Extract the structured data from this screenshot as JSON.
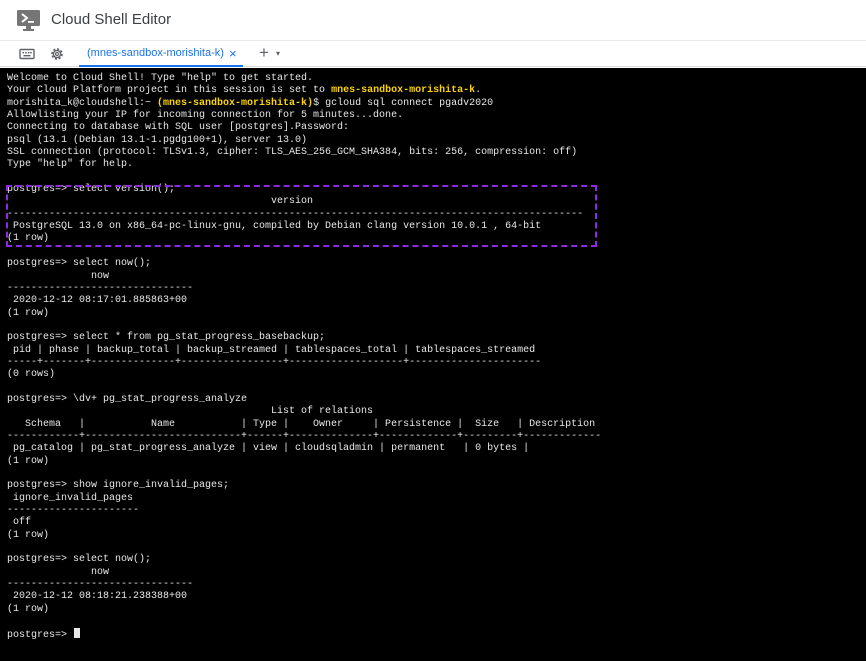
{
  "app": {
    "title": "Cloud Shell Editor"
  },
  "toolbar": {
    "keyboard_icon": "keyboard-icon",
    "settings_icon": "gear-icon",
    "tab_label": "(mnes-sandbox-morishita-k)",
    "tab_close": "×",
    "add_tab": "+",
    "add_caret": "▾"
  },
  "colors": {
    "tab_accent": "#1a73e8",
    "project_highlight": "#fbd400",
    "annotation_box": "#8a2be2",
    "terminal_bg": "#000000"
  },
  "terminal": {
    "l1": "Welcome to Cloud Shell! Type \"help\" to get started.",
    "l2_pre": "Your Cloud Platform project in this session is set to ",
    "l2_proj": "mnes-sandbox-morishita-k",
    "l2_post": ".",
    "l3_pre": "morishita_k@cloudshell:~ ",
    "l3_proj": "(mnes-sandbox-morishita-k)",
    "l3_post": "$ gcloud sql connect pgadv2020",
    "l4": "Allowlisting your IP for incoming connection for 5 minutes...done.",
    "l5": "Connecting to database with SQL user [postgres].Password:",
    "l6": "psql (13.1 (Debian 13.1-1.pgdg100+1), server 13.0)",
    "l7": "SSL connection (protocol: TLSv1.3, cipher: TLS_AES_256_GCM_SHA384, bits: 256, compression: off)",
    "l8": "Type \"help\" for help.",
    "l9": "",
    "l10": "postgres=> select version();",
    "l11": "                                            version",
    "l12": "------------------------------------------------------------------------------------------------",
    "l13": " PostgreSQL 13.0 on x86_64-pc-linux-gnu, compiled by Debian clang version 10.0.1 , 64-bit",
    "l14": "(1 row)",
    "l15": "",
    "l16": "postgres=> select now();",
    "l17": "              now",
    "l18": "-------------------------------",
    "l19": " 2020-12-12 08:17:01.885863+00",
    "l20": "(1 row)",
    "l21": "",
    "l22": "postgres=> select * from pg_stat_progress_basebackup;",
    "l23": " pid | phase | backup_total | backup_streamed | tablespaces_total | tablespaces_streamed",
    "l24": "-----+-------+--------------+-----------------+-------------------+----------------------",
    "l25": "(0 rows)",
    "l26": "",
    "l27": "postgres=> \\dv+ pg_stat_progress_analyze",
    "l28": "                                            List of relations",
    "l29": "   Schema   |           Name           | Type |    Owner     | Persistence |  Size   | Description",
    "l30": "------------+--------------------------+------+--------------+-------------+---------+-------------",
    "l31": " pg_catalog | pg_stat_progress_analyze | view | cloudsqladmin | permanent   | 0 bytes |",
    "l32": "(1 row)",
    "l33": "",
    "l34": "postgres=> show ignore_invalid_pages;",
    "l35": " ignore_invalid_pages",
    "l36": "----------------------",
    "l37": " off",
    "l38": "(1 row)",
    "l39": "",
    "l40": "postgres=> select now();",
    "l41": "              now",
    "l42": "-------------------------------",
    "l43": " 2020-12-12 08:18:21.238388+00",
    "l44": "(1 row)",
    "l45": "",
    "l46": "postgres=> "
  }
}
